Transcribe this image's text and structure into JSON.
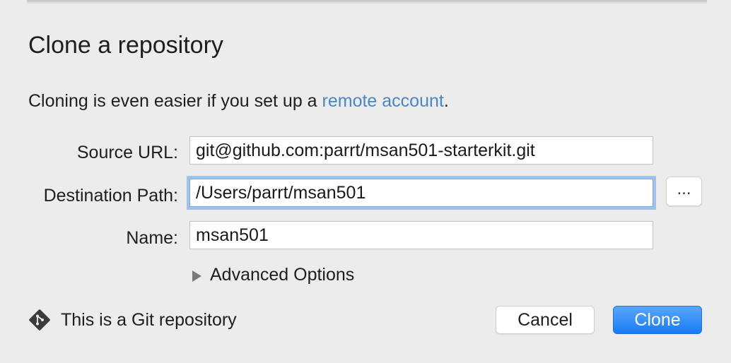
{
  "dialog": {
    "title": "Clone a repository",
    "info_text": "Cloning is even easier if you set up a ",
    "info_link": "remote account",
    "info_suffix": "."
  },
  "form": {
    "source_url": {
      "label": "Source URL:",
      "value": "git@github.com:parrt/msan501-starterkit.git"
    },
    "destination_path": {
      "label": "Destination Path:",
      "value": "/Users/parrt/msan501",
      "browse_label": "..."
    },
    "name": {
      "label": "Name:",
      "value": "msan501"
    },
    "advanced_options_label": "Advanced Options"
  },
  "footer": {
    "repo_type_icon": "git-diamond-icon",
    "repo_type_text": "This is a Git repository",
    "cancel_label": "Cancel",
    "clone_label": "Clone"
  },
  "colors": {
    "link": "#4a86c1",
    "primary_button": "#1a7bf5",
    "focus_ring": "#9ec2ea",
    "background": "#ececec"
  }
}
